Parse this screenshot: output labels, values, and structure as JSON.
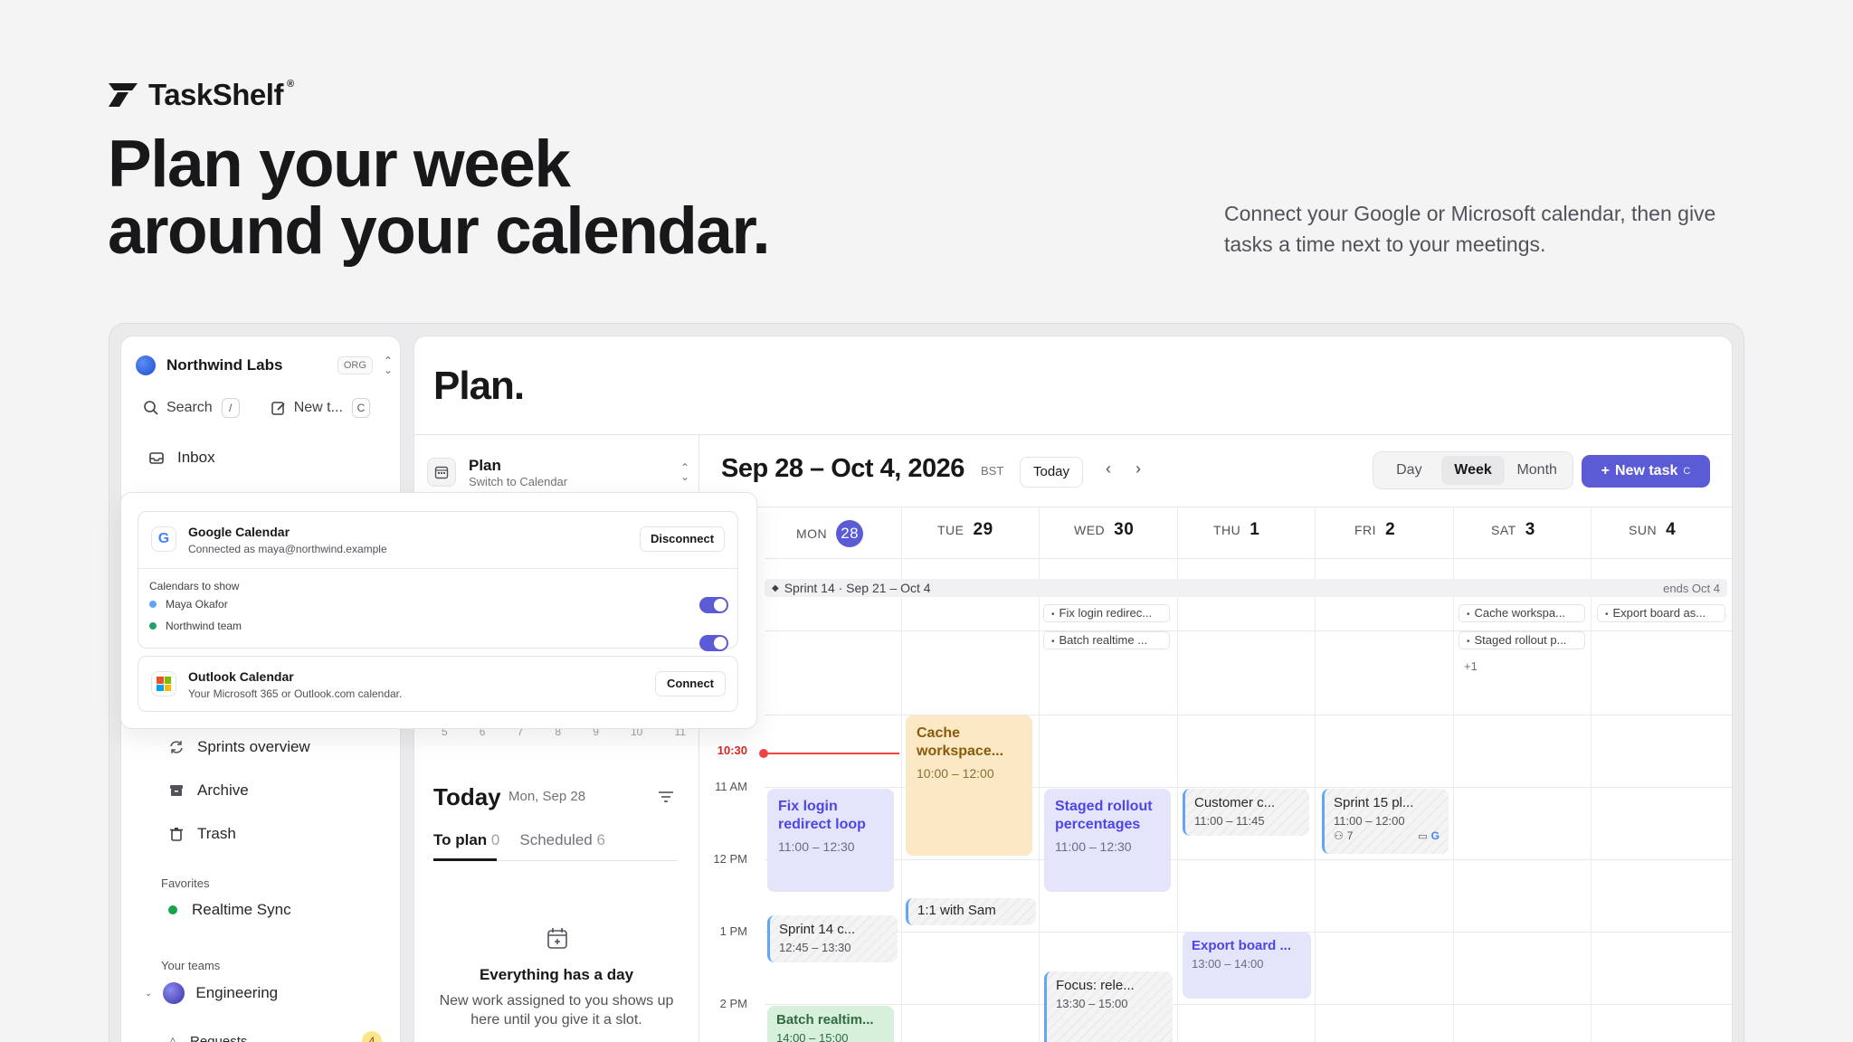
{
  "brand": {
    "name": "TaskShelf",
    "reg": "®"
  },
  "hero": {
    "title_line1": "Plan your week",
    "title_line2": "around your calendar.",
    "subtitle": "Connect your Google or Microsoft calendar, then give tasks a time next to your meetings."
  },
  "sidebar": {
    "org_name": "Northwind Labs",
    "org_badge": "ORG",
    "search_label": "Search",
    "search_kbd": "/",
    "new_label": "New t...",
    "new_kbd": "C",
    "inbox_label": "Inbox",
    "sprints_label": "Sprints overview",
    "archive_label": "Archive",
    "trash_label": "Trash",
    "favorites_label": "Favorites",
    "favorite_item": "Realtime Sync",
    "teams_label": "Your teams",
    "team_name": "Engineering",
    "requests_label": "Requests",
    "requests_count": "4"
  },
  "main": {
    "title": "Plan.",
    "plan_switch": {
      "title": "Plan",
      "subtitle": "Switch to Calendar"
    },
    "mini_days": [
      "5",
      "6",
      "7",
      "8",
      "9",
      "10",
      "11"
    ],
    "today": {
      "title": "Today",
      "date": "Mon, Sep 28",
      "tab_plan": "To plan",
      "tab_plan_count": "0",
      "tab_scheduled": "Scheduled",
      "tab_scheduled_count": "6",
      "empty_title": "Everything has a day",
      "empty_text": "New work assigned to you shows up here until you give it a slot."
    }
  },
  "calendar": {
    "range": "Sep 28 – Oct 4, 2026",
    "tz": "BST",
    "today_btn": "Today",
    "views": [
      "Day",
      "Week",
      "Month"
    ],
    "active_view": "Week",
    "new_task": "New task",
    "new_task_kbd": "C",
    "days": [
      {
        "dow": "MON",
        "num": "28",
        "today": true
      },
      {
        "dow": "TUE",
        "num": "29"
      },
      {
        "dow": "WED",
        "num": "30"
      },
      {
        "dow": "THU",
        "num": "1"
      },
      {
        "dow": "FRI",
        "num": "2"
      },
      {
        "dow": "SAT",
        "num": "3"
      },
      {
        "dow": "SUN",
        "num": "4"
      }
    ],
    "sprint": {
      "label": "Sprint 14 · Sep 21 – Oct 4",
      "ends": "ends Oct 4"
    },
    "allday_chips": {
      "wed_1": "Fix login redirec...",
      "wed_2": "Batch realtime ...",
      "sat_1": "Cache workspa...",
      "sat_2": "Staged rollout p...",
      "sat_more": "+1",
      "sun_1": "Export board as..."
    },
    "times": {
      "now": "10:30",
      "t11": "11 AM",
      "t12": "12 PM",
      "t1": "1 PM",
      "t2": "2 PM"
    },
    "events": {
      "cache": {
        "title": "Cache workspace...",
        "time": "10:00 – 12:00"
      },
      "fixlogin": {
        "title": "Fix login redirect loop",
        "time": "11:00 – 12:30"
      },
      "staged": {
        "title": "Staged rollout percentages",
        "time": "11:00 – 12:30"
      },
      "customer": {
        "title": "Customer c...",
        "time": "11:00 – 11:45"
      },
      "sprint15": {
        "title": "Sprint 15 pl...",
        "time": "11:00 – 12:00",
        "attendees": "7"
      },
      "oneone": {
        "title": "1:1 with Sam"
      },
      "sprint14": {
        "title": "Sprint 14 c...",
        "time": "12:45 – 13:30"
      },
      "export": {
        "title": "Export board ...",
        "time": "13:00 – 14:00"
      },
      "focus": {
        "title": "Focus: rele...",
        "time": "13:30 – 15:00"
      },
      "batch": {
        "title": "Batch realtim...",
        "time": "14:00 – 15:00"
      }
    }
  },
  "popover": {
    "google": {
      "title": "Google Calendar",
      "sub": "Connected as maya@northwind.example",
      "btn": "Disconnect"
    },
    "show_label": "Calendars to show",
    "cals": [
      {
        "name": "Maya Okafor",
        "color": "#60a5fa"
      },
      {
        "name": "Northwind team",
        "color": "#22a06b"
      }
    ],
    "outlook": {
      "title": "Outlook Calendar",
      "sub": "Your Microsoft 365 or Outlook.com calendar.",
      "btn": "Connect"
    }
  },
  "colors": {
    "accent": "#5b5bd6",
    "now": "#ef4444"
  }
}
